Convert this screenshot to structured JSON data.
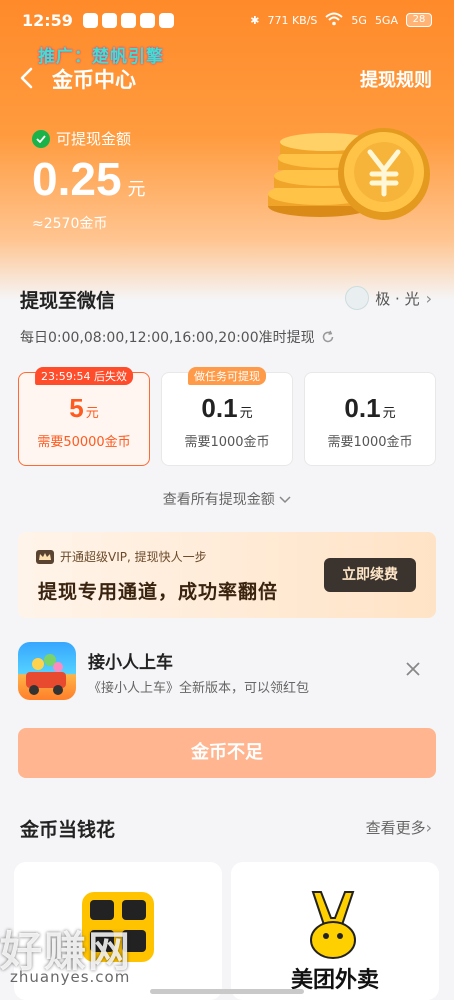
{
  "status_bar": {
    "time": "12:59",
    "network_speed": "771 KB/S",
    "signal_a": "5G",
    "signal_b": "5GA",
    "battery": "28"
  },
  "promo_overlay": "推广：楚帆引擎",
  "nav": {
    "title": "金币中心",
    "rules": "提现规则"
  },
  "balance": {
    "label": "可提现金额",
    "amount": "0.25",
    "unit": "元",
    "coins_equiv": "≈2570金币"
  },
  "withdraw": {
    "title": "提现至微信",
    "account_name": "极 · 光",
    "schedule": "每日0:00,08:00,12:00,16:00,20:00准时提现",
    "options": [
      {
        "badge": "23:59:54 后失效",
        "value": "5",
        "unit": "元",
        "need": "需要50000金币",
        "selected": true
      },
      {
        "badge": "做任务可提现",
        "value": "0.1",
        "unit": "元",
        "need": "需要1000金币",
        "selected": false
      },
      {
        "badge": "",
        "value": "0.1",
        "unit": "元",
        "need": "需要1000金币",
        "selected": false
      }
    ],
    "see_all": "查看所有提现金额"
  },
  "vip_banner": {
    "tagline": "开通超级VIP, 提现快人一步",
    "headline": "提现专用通道，成功率翻倍",
    "button": "立即续费"
  },
  "ad": {
    "title": "接小人上车",
    "description": "《接小人上车》全新版本，可以领红包"
  },
  "cta": {
    "label": "金币不足"
  },
  "spend": {
    "title": "金币当钱花",
    "more": "查看更多",
    "cards": [
      {
        "name": ""
      },
      {
        "name": "美团外卖"
      }
    ]
  },
  "watermark": {
    "text": "好赚网",
    "url": "zhuanyes.com"
  },
  "colors": {
    "header_orange": "#ff8a2a",
    "accent_red": "#ff5a1f",
    "cta_disabled": "#ffb58f",
    "vip_button": "#3b332d"
  }
}
